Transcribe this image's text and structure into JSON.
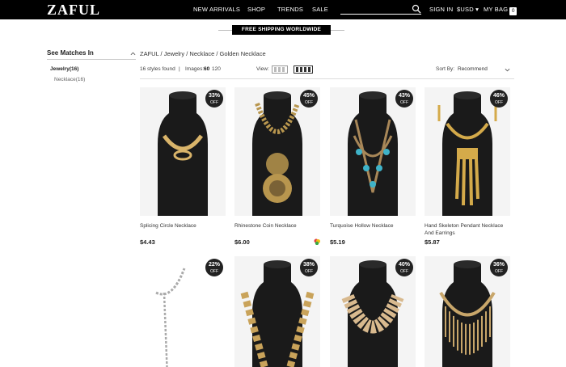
{
  "header": {
    "logo": "ZAFUL",
    "nav": [
      "NEW ARRIVALS",
      "SHOP",
      "TRENDS",
      "SALE"
    ],
    "search_placeholder": "",
    "signin": "SIGN IN",
    "currency": "$USD",
    "bag": "MY BAG",
    "bag_count": "0",
    "colors": {
      "bar": "#000000",
      "text": "#ffffff"
    }
  },
  "banner": {
    "text": "FREE SHIPPING WORLDWIDE"
  },
  "sidebar": {
    "title": "See Matches In",
    "category": "Jewelry(16)",
    "subcategory": "Necklace(16)"
  },
  "breadcrumb": "ZAFUL / Jewelry / Necklace / Golden Necklace",
  "toolbar": {
    "found": "16 styles found",
    "separator": "|",
    "images_label": "Images:",
    "images_selected": "60",
    "images_other": "120",
    "view_label": "View:",
    "sort_label": "Sort By:",
    "sort_value": "Recommend"
  },
  "products": [
    {
      "name": "Splicing Circle Necklace",
      "price": "$4.43",
      "discount": "33%",
      "off": "OFF",
      "icon": "necklace-image"
    },
    {
      "name": "Rhinestone Coin Necklace",
      "price": "$6.00",
      "discount": "45%",
      "off": "OFF",
      "icon": "necklace-image",
      "has_swatch": true
    },
    {
      "name": "Turquoise Hollow Necklace",
      "price": "$5.19",
      "discount": "43%",
      "off": "OFF",
      "icon": "necklace-image"
    },
    {
      "name": "Hand Skeleton Pendant Necklace And Earrings",
      "price": "$5.87",
      "discount": "46%",
      "off": "OFF",
      "icon": "necklace-image"
    },
    {
      "name": "",
      "price": "",
      "discount": "22%",
      "off": "OFF",
      "icon": "necklace-image"
    },
    {
      "name": "",
      "price": "",
      "discount": "38%",
      "off": "OFF",
      "icon": "necklace-image"
    },
    {
      "name": "",
      "price": "",
      "discount": "40%",
      "off": "OFF",
      "icon": "necklace-image"
    },
    {
      "name": "",
      "price": "",
      "discount": "36%",
      "off": "OFF",
      "icon": "necklace-image"
    }
  ]
}
